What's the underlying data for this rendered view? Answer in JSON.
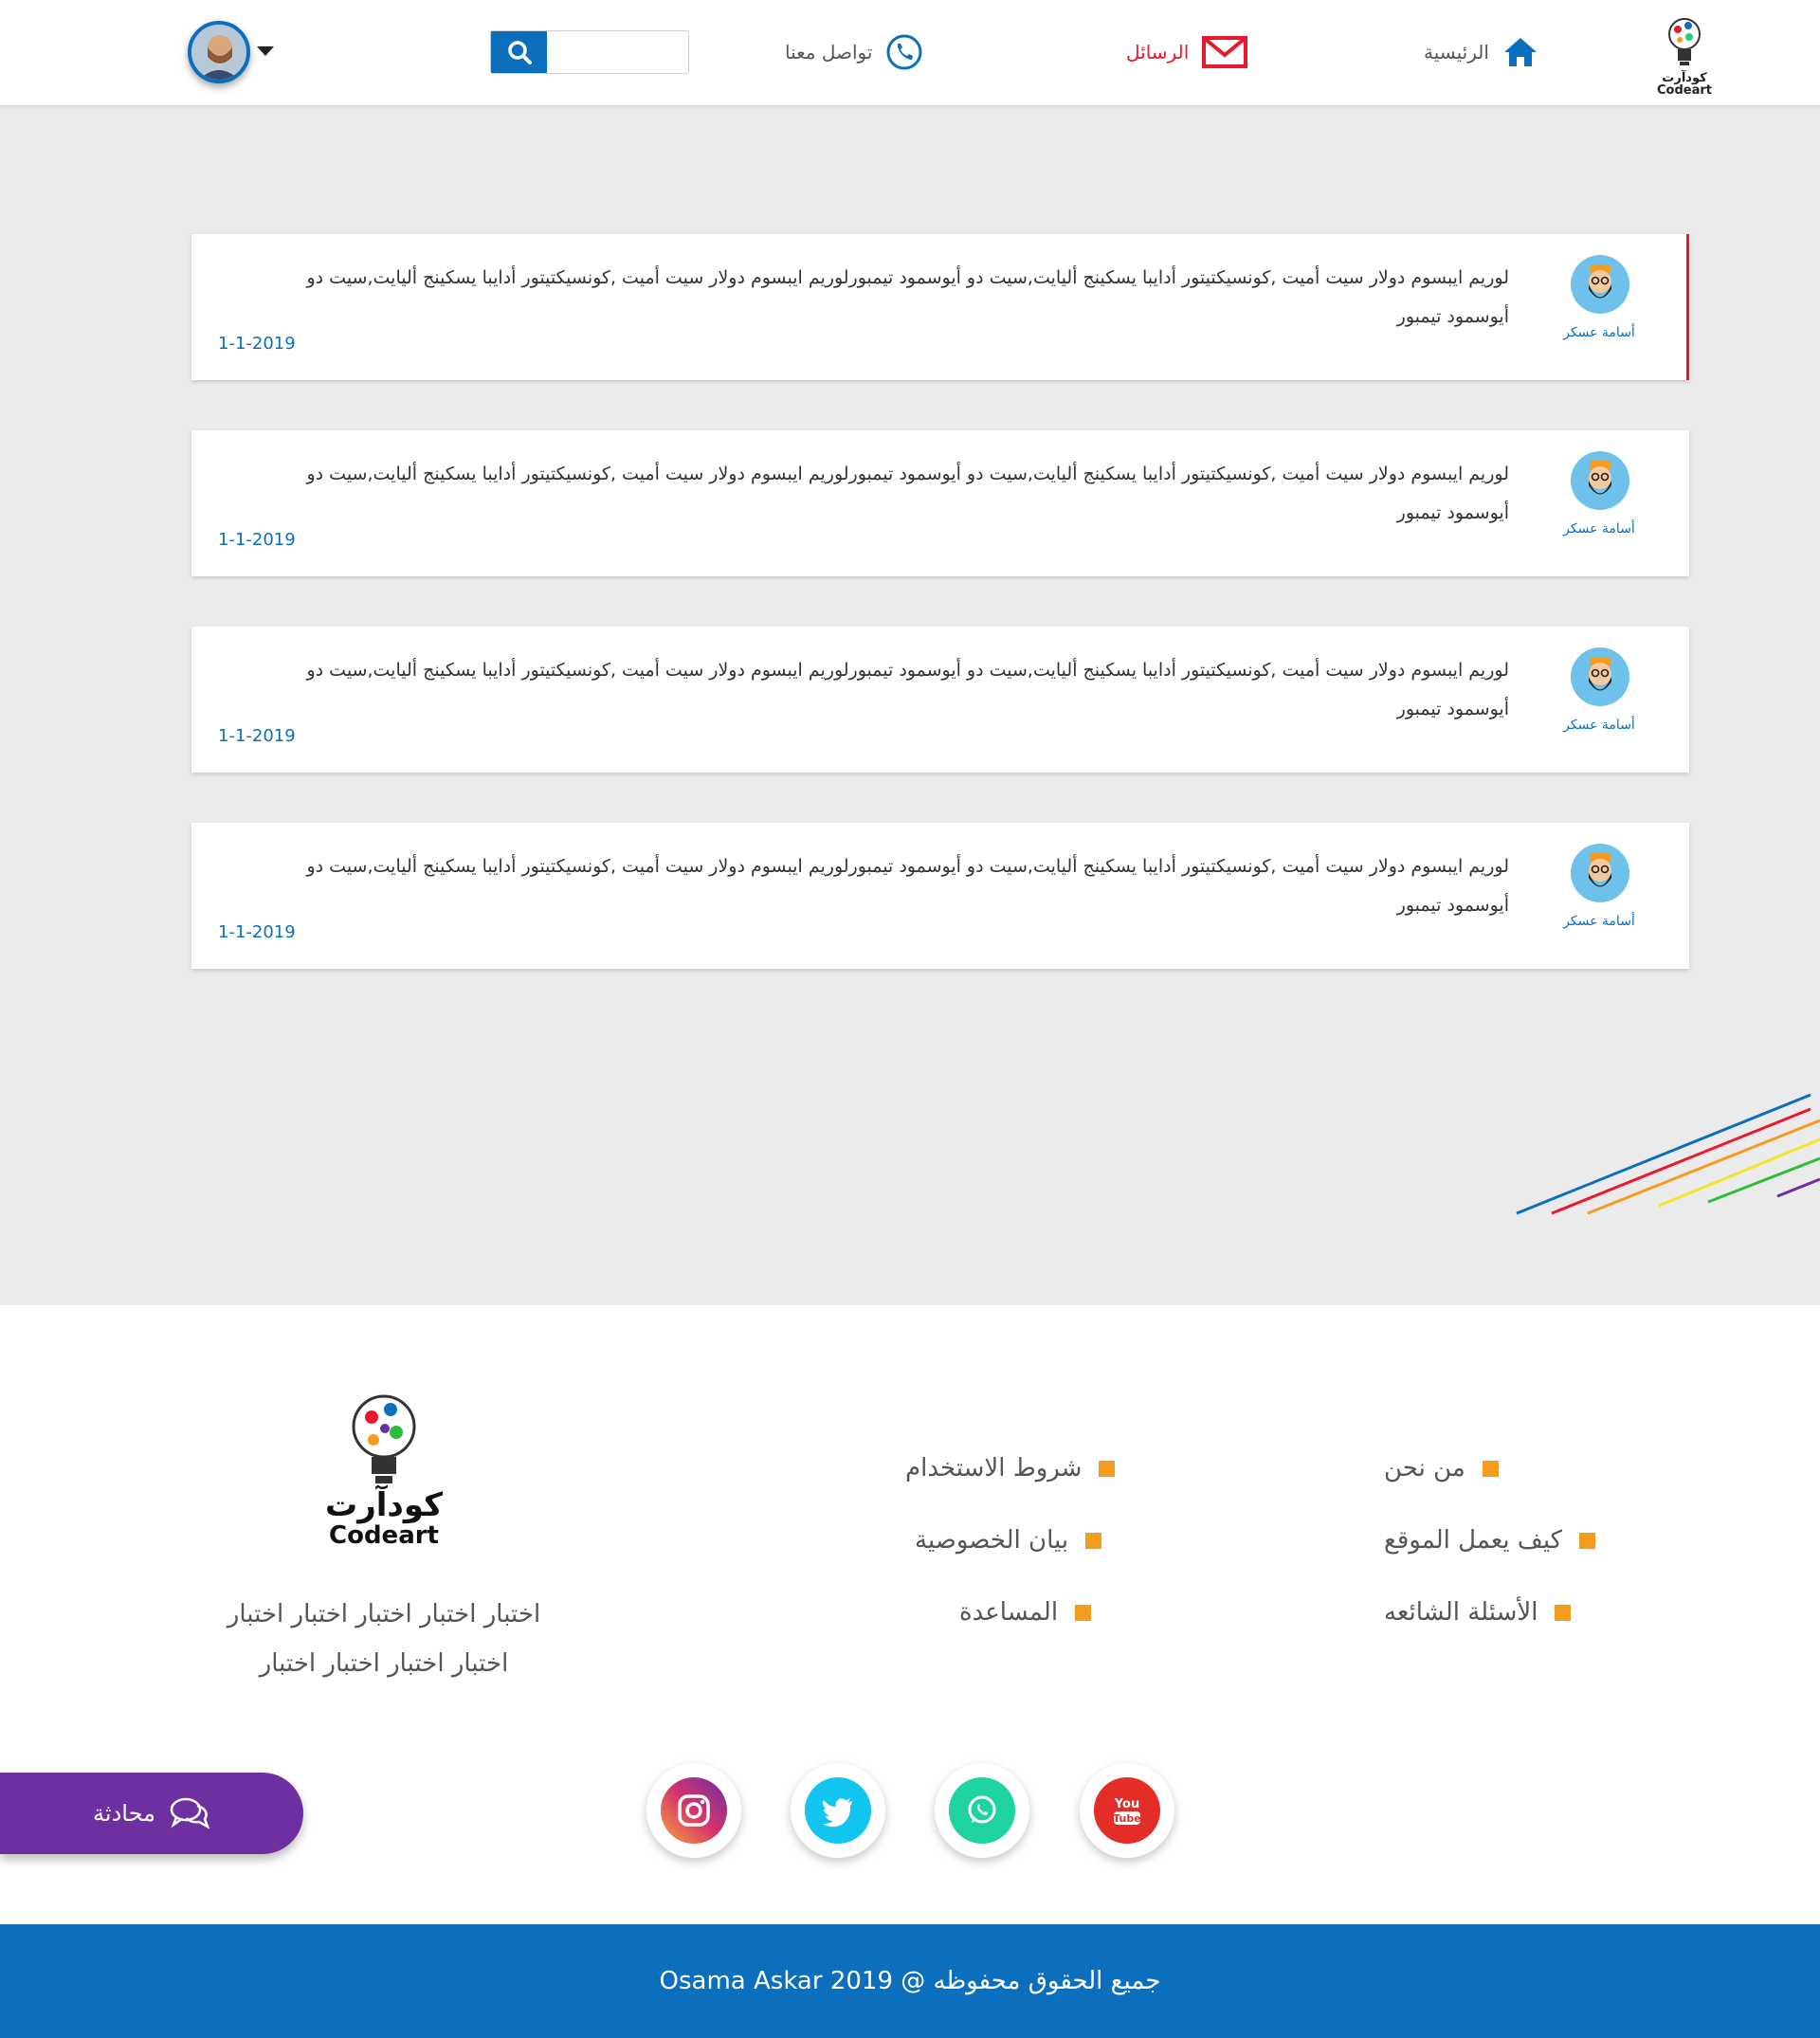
{
  "header": {
    "logo_text_ar": "كودآرت",
    "logo_text_en": "Codeart",
    "nav": {
      "home": "الرئيسية",
      "messages": "الرسائل",
      "contact": "تواصل معنا"
    },
    "search": {
      "placeholder": "",
      "value": ""
    }
  },
  "messages": [
    {
      "author": "أسامة عسكر",
      "text": "لوريم ايبسوم دولار سيت أميت ,كونسيكتيتور أدايبا يسكينج أليايت,سيت دو أيوسمود تيمبورلوريم ايبسوم دولار سيت أميت ,كونسيكتيتور أدايبا يسكينج أليايت,سيت دو أيوسمود تيمبور",
      "date": "1-1-2019"
    },
    {
      "author": "أسامة عسكر",
      "text": "لوريم ايبسوم دولار سيت أميت ,كونسيكتيتور أدايبا يسكينج أليايت,سيت دو أيوسمود تيمبورلوريم ايبسوم دولار سيت أميت ,كونسيكتيتور أدايبا يسكينج أليايت,سيت دو أيوسمود تيمبور",
      "date": "1-1-2019"
    },
    {
      "author": "أسامة عسكر",
      "text": "لوريم ايبسوم دولار سيت أميت ,كونسيكتيتور أدايبا يسكينج أليايت,سيت دو أيوسمود تيمبورلوريم ايبسوم دولار سيت أميت ,كونسيكتيتور أدايبا يسكينج أليايت,سيت دو أيوسمود تيمبور",
      "date": "1-1-2019"
    },
    {
      "author": "أسامة عسكر",
      "text": "لوريم ايبسوم دولار سيت أميت ,كونسيكتيتور أدايبا يسكينج أليايت,سيت دو أيوسمود تيمبورلوريم ايبسوم دولار سيت أميت ,كونسيكتيتور أدايبا يسكينج أليايت,سيت دو أيوسمود تيمبور",
      "date": "1-1-2019"
    }
  ],
  "footer": {
    "links_col1": [
      "من نحن",
      "كيف يعمل الموقع",
      "الأسئلة الشائعه"
    ],
    "links_col2": [
      "شروط الاستخدام",
      "بيان الخصوصية",
      "المساعدة"
    ],
    "logo_text_ar": "كودآرت",
    "logo_text_en": "Codeart",
    "description": "اختبار اختبار اختبار اختبار اختبار اختبار اختبار اختبار اختبار",
    "social": [
      "youtube-icon",
      "whatsapp-icon",
      "twitter-icon",
      "instagram-icon"
    ],
    "chat_label": "محادثة",
    "copyright": "جميع الحقوق محفوظه @  2019  Osama Askar"
  },
  "colors": {
    "brand_blue": "#0b6fbd",
    "alert_red": "#e8192c",
    "accent_orange": "#f39c20",
    "chat_purple": "#6e2fa0"
  }
}
